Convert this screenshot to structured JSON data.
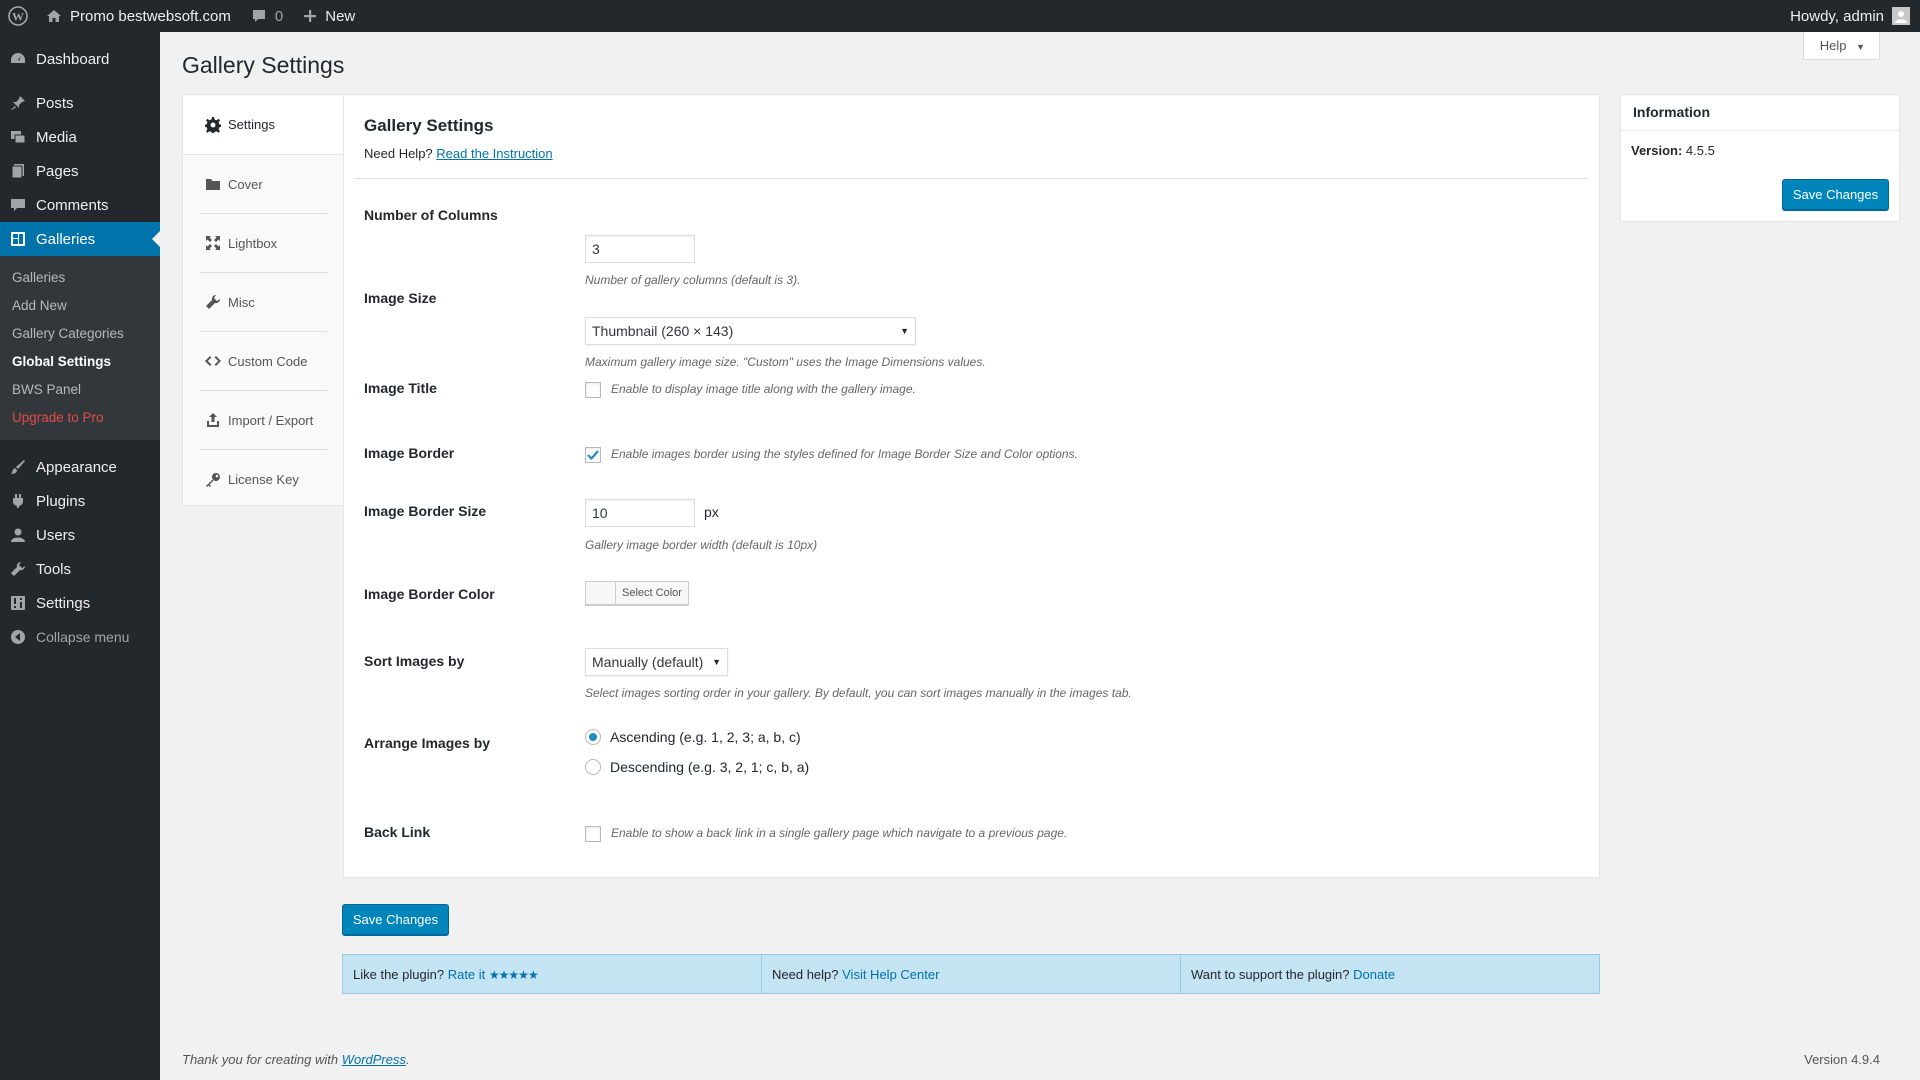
{
  "adminbar": {
    "site_name": "Promo bestwebsoft.com",
    "comments_count": "0",
    "new_label": "New",
    "howdy": "Howdy, admin"
  },
  "sidebar": {
    "items": [
      {
        "label": "Dashboard",
        "icon": "dashboard-icon"
      },
      {
        "label": "Posts",
        "icon": "pin-icon"
      },
      {
        "label": "Media",
        "icon": "media-icon"
      },
      {
        "label": "Pages",
        "icon": "pages-icon"
      },
      {
        "label": "Comments",
        "icon": "comment-icon"
      },
      {
        "label": "Galleries",
        "icon": "gallery-icon"
      },
      {
        "label": "Appearance",
        "icon": "brush-icon"
      },
      {
        "label": "Plugins",
        "icon": "plugin-icon"
      },
      {
        "label": "Users",
        "icon": "user-icon"
      },
      {
        "label": "Tools",
        "icon": "wrench-icon"
      },
      {
        "label": "Settings",
        "icon": "settings-icon"
      }
    ],
    "submenu": [
      "Galleries",
      "Add New",
      "Gallery Categories",
      "Global Settings",
      "BWS Panel",
      "Upgrade to Pro"
    ],
    "collapse": "Collapse menu"
  },
  "help_tab": "Help",
  "page_title": "Gallery Settings",
  "tabs": [
    "Settings",
    "Cover",
    "Lightbox",
    "Misc",
    "Custom Code",
    "Import / Export",
    "License Key"
  ],
  "panel": {
    "title": "Gallery Settings",
    "need_help": "Need Help?",
    "read_link": "Read the Instruction",
    "fields": {
      "columns": {
        "label": "Number of Columns",
        "value": "3",
        "desc": "Number of gallery columns (default is 3)."
      },
      "image_size": {
        "label": "Image Size",
        "value": "Thumbnail (260 × 143)",
        "desc": "Maximum gallery image size. \"Custom\" uses the Image Dimensions values."
      },
      "image_title": {
        "label": "Image Title",
        "checked": false,
        "text": "Enable to display image title along with the gallery image."
      },
      "image_border": {
        "label": "Image Border",
        "checked": true,
        "text": "Enable images border using the styles defined for Image Border Size and Color options."
      },
      "border_size": {
        "label": "Image Border Size",
        "value": "10",
        "unit": "px",
        "desc": "Gallery image border width (default is 10px)"
      },
      "border_color": {
        "label": "Image Border Color",
        "button": "Select Color"
      },
      "sort_by": {
        "label": "Sort Images by",
        "value": "Manually (default)",
        "desc": "Select images sorting order in your gallery. By default, you can sort images manually in the images tab."
      },
      "arrange_by": {
        "label": "Arrange Images by",
        "options": [
          "Ascending (e.g. 1, 2, 3; a, b, c)",
          "Descending (e.g. 3, 2, 1; c, b, a)"
        ],
        "selected": 0
      },
      "back_link": {
        "label": "Back Link",
        "checked": false,
        "text": "Enable to show a back link in a single gallery page which navigate to a previous page."
      }
    }
  },
  "save_label": "Save Changes",
  "info": {
    "title": "Information",
    "version_label": "Version:",
    "version_value": "4.5.5"
  },
  "footer_bar": {
    "like": "Like the plugin?",
    "rate": "Rate it",
    "stars": "★★★★★",
    "need": "Need help?",
    "visit": "Visit Help Center",
    "support": "Want to support the plugin?",
    "donate": "Donate"
  },
  "footer": {
    "thanks": "Thank you for creating with",
    "wp_link": "WordPress",
    "period": ".",
    "version": "Version 4.9.4"
  },
  "colors": {
    "accent": "#0073aa",
    "button": "#0085ba",
    "sidebar": "#23282d",
    "footer_bar": "#c4e3f3"
  }
}
